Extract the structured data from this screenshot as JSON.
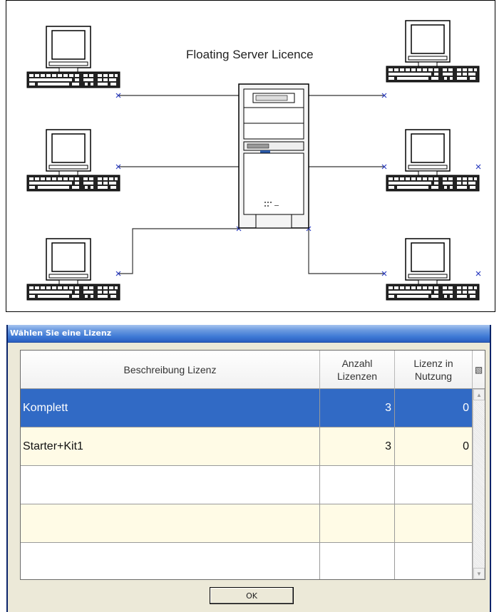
{
  "diagram": {
    "title": "Floating Server Licence"
  },
  "dialog": {
    "title": "Wählen Sie eine Lizenz",
    "columns": {
      "description": "Beschreibung Lizenz",
      "count": "Anzahl\nLizenzen",
      "in_use": "Lizenz in\nNutzung"
    },
    "rows": [
      {
        "description": "Komplett",
        "count": "3",
        "in_use": "0",
        "selected": true
      },
      {
        "description": "Starter+Kit1",
        "count": "3",
        "in_use": "0",
        "selected": false
      },
      {
        "description": "",
        "count": "",
        "in_use": "",
        "selected": false
      },
      {
        "description": "",
        "count": "",
        "in_use": "",
        "selected": false
      },
      {
        "description": "",
        "count": "",
        "in_use": "",
        "selected": false
      }
    ],
    "ok_label": "OK"
  },
  "colors": {
    "selection": "#316ac5",
    "alt_row": "#fffbe6",
    "titlebar": "#3d78d5",
    "dialog_bg": "#ece9d8"
  },
  "icons": {
    "workstation": "computer-icon",
    "server": "server-tower-icon",
    "header_button": "column-chooser-icon"
  }
}
